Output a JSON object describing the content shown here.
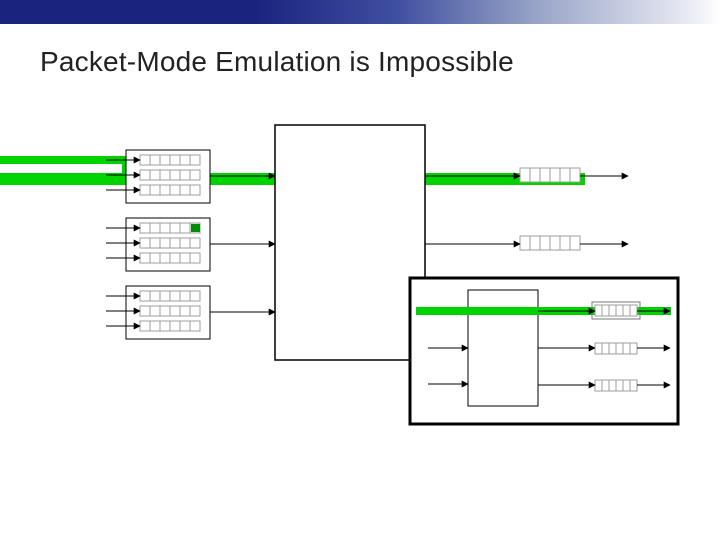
{
  "title": "Packet-Mode Emulation is Impossible",
  "colors": {
    "green": "#00c400",
    "green_dark": "#009000",
    "black": "#000000",
    "grey": "#9e9e9e"
  },
  "diagram": {
    "type": "block-diagram",
    "description": "Three input line-card blocks (each 3 queues) feed a central switch fabric block; three output queues on the right. A thick horizontal green path highlights the top port traversal. An inset at lower right shows a mini switch with one highlighted output port.",
    "input_cards": 3,
    "queues_per_card": 3,
    "cells_per_queue": 6,
    "output_queues": 3,
    "inset": {
      "inputs": 3,
      "outputs": 3,
      "highlight_output_index": 0
    },
    "highlight_input_card": 0
  }
}
